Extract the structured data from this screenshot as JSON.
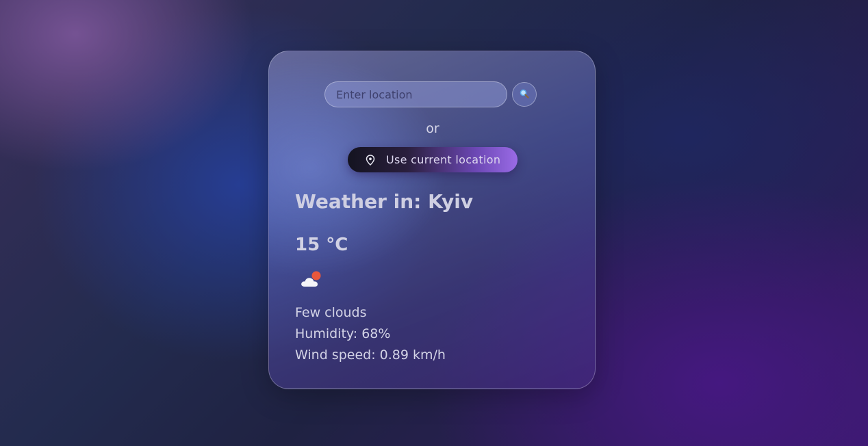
{
  "search": {
    "placeholder": "Enter location",
    "button_icon": "search-icon"
  },
  "divider_text": "or",
  "location_button": {
    "label": "Use current location",
    "icon": "map-pin-icon"
  },
  "weather": {
    "title": "Weather in: Kyiv",
    "temperature": "15 °C",
    "icon": "few-clouds-icon",
    "description": "Few clouds",
    "humidity": "Humidity: 68%",
    "wind": "Wind speed: 0.89 km/h"
  },
  "colors": {
    "accent": "#9a6be6",
    "button_dark": "#141320",
    "sun": "#e8573c"
  }
}
